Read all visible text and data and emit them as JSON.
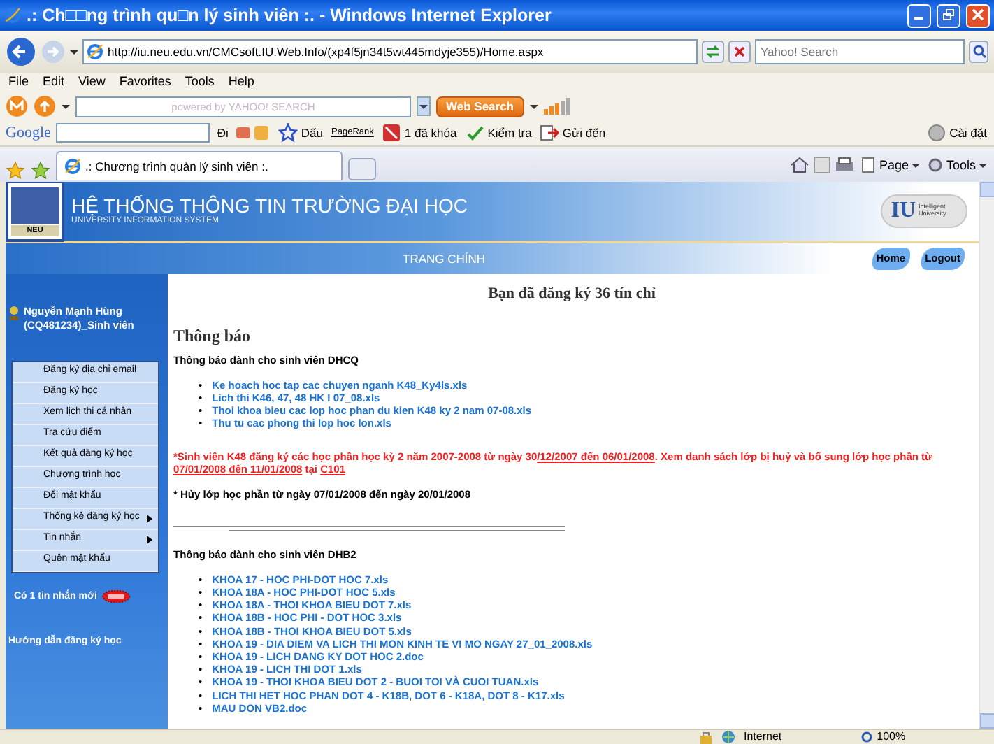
{
  "window": {
    "title": ".: Ch□□ng trình qu□n lý sinh viên :. - Windows Internet Explorer"
  },
  "address_bar": {
    "url": "http://iu.neu.edu.vn/CMCsoft.IU.Web.Info/(xp4f5jn34t5wt445mdyje355)/Home.aspx",
    "search_placeholder": "Yahoo! Search"
  },
  "menu_bar": [
    "File",
    "Edit",
    "View",
    "Favorites",
    "Tools",
    "Help"
  ],
  "yahoo_toolbar": {
    "search_placeholder": "powered by YAHOO! SEARCH",
    "search_button": "Web Search"
  },
  "google_toolbar": {
    "logo": "Google",
    "items": [
      "Đi",
      "Dấu",
      "PageRank",
      "1 đã khóa",
      "Kiểm tra",
      "Gửi đến",
      "Cài đặt"
    ]
  },
  "tabs": [
    {
      "label": ".: Chương trình quản lý sinh viên :.",
      "selected": true
    }
  ],
  "command_bar": [
    "Page",
    "Tools"
  ],
  "page": {
    "header": {
      "title": "HỆ THỐNG THÔNG TIN TRƯỜNG ĐẠI HỌC",
      "subtitle": "UNIVERSITY INFORMATION SYSTEM",
      "logo_text": "NEU",
      "right_logo": {
        "mark": "IU",
        "text": "Intelligent University"
      }
    },
    "nav": {
      "title": "TRANG CHÍNH",
      "links": [
        "Home",
        "Logout"
      ]
    },
    "sidebar": {
      "user": "Nguyễn Mạnh Hùng (CQ481234)_Sinh viên",
      "menu": [
        {
          "label": "Đăng ký địa chỉ email",
          "submenu": false
        },
        {
          "label": "Đăng ký học",
          "submenu": false
        },
        {
          "label": "Xem lịch thi cá nhân",
          "submenu": false
        },
        {
          "label": "Tra cứu điểm",
          "submenu": false
        },
        {
          "label": "Kết quả đăng ký học",
          "submenu": false
        },
        {
          "label": "Chương trình học",
          "submenu": false
        },
        {
          "label": "Đổi mật khẩu",
          "submenu": false
        },
        {
          "label": "Thống kê đăng ký học",
          "submenu": true
        },
        {
          "label": "Tin nhắn",
          "submenu": true
        },
        {
          "label": "Quên mật khẩu",
          "submenu": false
        }
      ],
      "messages": "Có 1 tin nhắn mới",
      "guide": "Hướng dẫn đăng ký học"
    },
    "content": {
      "credits": "Bạn đã đăng ký 36 tín chỉ",
      "heading": "Thông báo",
      "section_1": {
        "title": "Thông báo dành cho sinh viên DHCQ",
        "bullet": "•",
        "links": [
          "Ke hoach hoc tap cac chuyen nganh K48_Ky4ls.xls",
          "Lich thi K46, 47, 48 HK I 07_08.xls",
          "Thoi khoa bieu cac lop hoc phan du kien K48 ky 2 nam 07-08.xls",
          "Thu tu cac phong thi lop hoc lon.xls"
        ]
      },
      "notice": [
        {
          "text": "*Sinh viên K48 đăng ký các học phần học kỳ 2 năm 2007-2008 từ ngày 30",
          "link": false
        },
        {
          "text": "/12/2007 đến 06/01/2008",
          "link": true
        },
        {
          "text": ". Xem danh sách lớp bị huỷ và bổ sung lớp học phần từ ",
          "link": false
        },
        {
          "text": "07/01/2008 đến 11/01/2008",
          "link": true
        },
        {
          "text": " tại ",
          "link": false
        },
        {
          "text": "C101",
          "link": true
        }
      ],
      "cancel_notice": "* Hủy lớp học phần từ ngày 07/01/2008 đến ngày 20/01/2008",
      "section_2": {
        "title": "Thông báo dành cho sinh viên DHB2",
        "bullet": "•",
        "links": [
          "KHOA 17 - HOC PHI-DOT HOC 7.xls",
          "KHOA 18A - HOC PHI-DOT HOC 5.xls",
          "KHOA 18A - THOI KHOA BIEU DOT 7.xls",
          "KHOA 18B - HOC PHI - DOT HOC 3.xls",
          "KHOA 18B - THOI KHOA BIEU DOT 5.xls",
          "KHOA 19 - DIA DIEM VA LICH THI MON KINH TE VI MO NGAY 27_01_2008.xls",
          "KHOA 19 - LICH DANG KY DOT HOC 2.doc",
          "KHOA 19 - LICH THI DOT 1.xls",
          "KHOA 19 - THOI KHOA BIEU DOT 2 - BUOI TOI VÀ CUOI TUAN.xls",
          "LICH THI HET HOC PHAN DOT 4 - K18B, DOT 6 - K18A, DOT 8 - K17.xls",
          "MAU DON VB2.doc"
        ]
      }
    }
  },
  "status_bar": {
    "zone": "Internet",
    "zoom": "100%"
  }
}
